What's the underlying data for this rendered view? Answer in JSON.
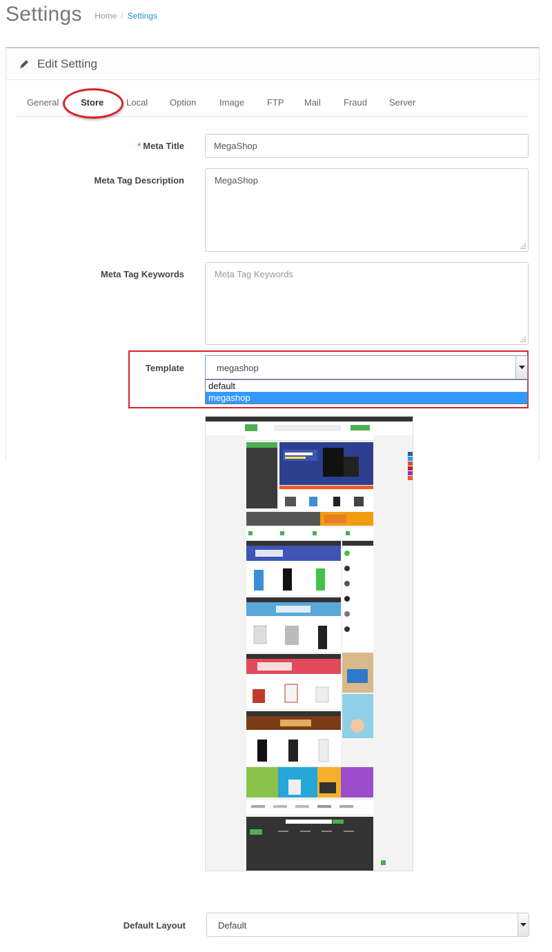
{
  "header": {
    "title": "Settings",
    "breadcrumb": {
      "home": "Home",
      "separator": "/",
      "current": "Settings"
    }
  },
  "panel": {
    "title": "Edit Setting",
    "icon": "pencil-icon"
  },
  "tabs": [
    {
      "label": "General",
      "active": false
    },
    {
      "label": "Store",
      "active": true
    },
    {
      "label": "Local",
      "active": false
    },
    {
      "label": "Option",
      "active": false
    },
    {
      "label": "Image",
      "active": false
    },
    {
      "label": "FTP",
      "active": false
    },
    {
      "label": "Mail",
      "active": false
    },
    {
      "label": "Fraud",
      "active": false
    },
    {
      "label": "Server",
      "active": false
    }
  ],
  "form": {
    "meta_title": {
      "required_mark": "*",
      "label": "Meta Title",
      "value": "MegaShop"
    },
    "meta_description": {
      "label": "Meta Tag Description",
      "value": "MegaShop"
    },
    "meta_keywords": {
      "label": "Meta Tag Keywords",
      "value": "",
      "placeholder": "Meta Tag Keywords"
    },
    "template": {
      "label": "Template",
      "value": "megashop",
      "options": [
        "default",
        "megashop"
      ],
      "highlighted_option": "megashop"
    },
    "default_layout": {
      "label": "Default Layout",
      "value": "Default"
    }
  },
  "colors": {
    "accent": "#1e91cf",
    "annotation_red": "#d9222a",
    "selected_option": "#3399ff",
    "required": "#f56b6b"
  },
  "template_preview": {
    "content": "MegaShop storefront thumbnail"
  }
}
